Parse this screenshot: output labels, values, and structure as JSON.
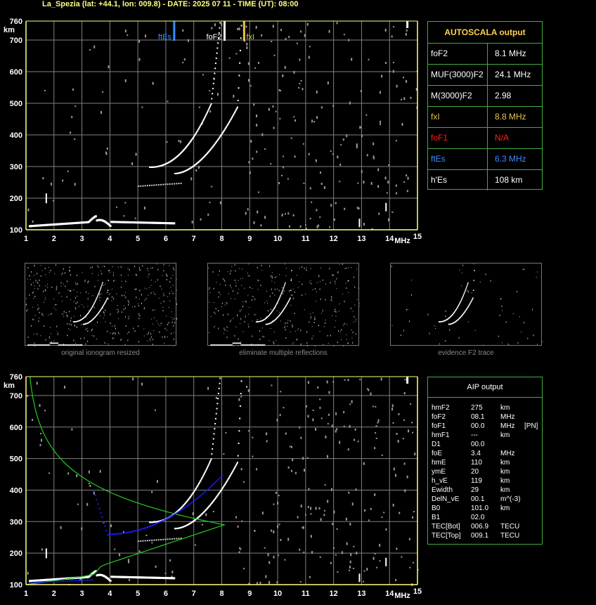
{
  "header": {
    "title": "La_Spezia (lat: +44.1, lon: 009.8) - DATE: 2025 07 11 - TIME (UT): 08:00"
  },
  "axes": {
    "x_ticks": [
      "1",
      "2",
      "3",
      "4",
      "5",
      "6",
      "7",
      "8",
      "9",
      "10",
      "11",
      "12",
      "13",
      "14",
      "15"
    ],
    "x_unit": "MHz",
    "y_ticks": [
      "100",
      "200",
      "300",
      "400",
      "500",
      "600",
      "700",
      "760"
    ],
    "y_unit": "km"
  },
  "top_markers": {
    "ftEs": "ftEs",
    "foF2": "foF2",
    "fxI": "fxI"
  },
  "autoscala": {
    "title": "AUTOSCALA output",
    "rows": [
      {
        "key": "foF2",
        "value": "8.1 MHz",
        "color": "#ffffff"
      },
      {
        "key": "MUF(3000)F2",
        "value": "24.1 MHz",
        "color": "#ffffff"
      },
      {
        "key": "M(3000)F2",
        "value": "2.98",
        "color": "#ffffff"
      },
      {
        "key": "fxI",
        "value": "8.8 MHz",
        "color": "#e6c84a"
      },
      {
        "key": "foF1",
        "value": "N/A",
        "color": "#ff2020"
      },
      {
        "key": "ftEs",
        "value": "6.3 MHz",
        "color": "#3a8cff"
      },
      {
        "key": "h'Es",
        "value": "108     km",
        "color": "#ffffff"
      }
    ]
  },
  "thumbnails": [
    {
      "caption": "original ionogram resized"
    },
    {
      "caption": "eliminate multiple reflections"
    },
    {
      "caption": "evidence F2 trace"
    }
  ],
  "aip": {
    "title": "AIP output",
    "rows": [
      {
        "k": "hmF2",
        "v": "275",
        "u": "km",
        "x": ""
      },
      {
        "k": "foF2",
        "v": "08.1",
        "u": "MHz",
        "x": ""
      },
      {
        "k": "foF1",
        "v": "00.0",
        "u": "MHz",
        "x": "[PN]"
      },
      {
        "k": "hmF1",
        "v": "---",
        "u": "km",
        "x": ""
      },
      {
        "k": "D1",
        "v": "00.0",
        "u": "",
        "x": ""
      },
      {
        "k": "foE",
        "v": "3.4",
        "u": "MHz",
        "x": ""
      },
      {
        "k": "hmE",
        "v": "110",
        "u": "km",
        "x": ""
      },
      {
        "k": "ymE",
        "v": "20",
        "u": "km",
        "x": ""
      },
      {
        "k": "h_vE",
        "v": "119",
        "u": "km",
        "x": ""
      },
      {
        "k": "Ewidth",
        "v": "29",
        "u": "km",
        "x": ""
      },
      {
        "k": "DelN_vE",
        "v": "00.1",
        "u": "m^(-3)",
        "x": ""
      },
      {
        "k": "B0",
        "v": "101.0",
        "u": "km",
        "x": ""
      },
      {
        "k": "B1",
        "v": "02.0",
        "u": "",
        "x": ""
      },
      {
        "k": "TEC[Bot]",
        "v": "006.9",
        "u": "TECU",
        "x": ""
      },
      {
        "k": "TEC[Top]",
        "v": "009.1",
        "u": "TECU",
        "x": ""
      }
    ]
  },
  "colors": {
    "grid": "#808080",
    "axis_frame": "#ffff80",
    "panel_border": "#3fae3f",
    "ftEs_marker": "#3a8cff",
    "foF2_marker": "#ffffff",
    "fxI_marker": "#e6c84a",
    "profile_curve": "#22cc22",
    "aip_trace": "#1a1aff"
  }
}
